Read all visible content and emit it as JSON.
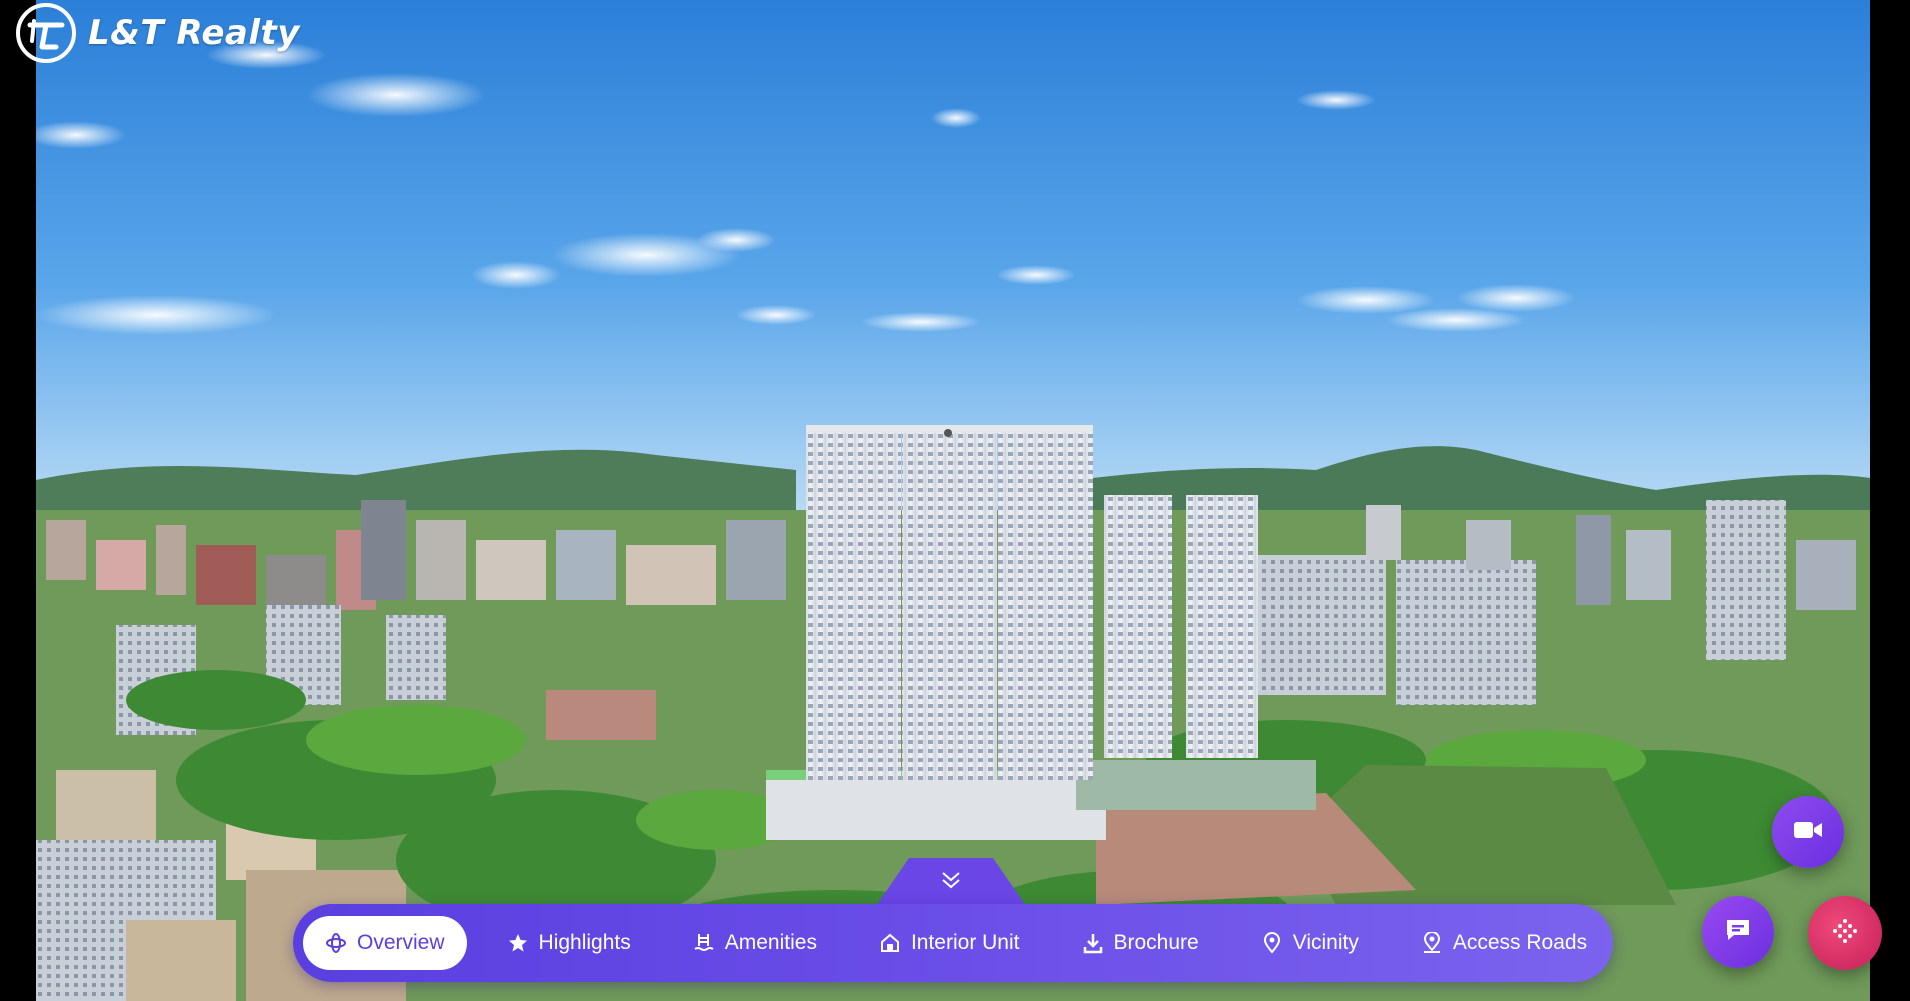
{
  "brand": {
    "logo_text": "L&T Realty",
    "logo_icon": "lt-logo-icon"
  },
  "nav": {
    "collapse_icon": "chevron-down-icon",
    "items": [
      {
        "label": "Overview",
        "icon": "orbit-icon",
        "active": true
      },
      {
        "label": "Highlights",
        "icon": "star-icon",
        "active": false
      },
      {
        "label": "Amenities",
        "icon": "pool-ladder-icon",
        "active": false
      },
      {
        "label": "Interior Unit",
        "icon": "home-icon",
        "active": false
      },
      {
        "label": "Brochure",
        "icon": "download-icon",
        "active": false
      },
      {
        "label": "Vicinity",
        "icon": "location-pin-icon",
        "active": false
      },
      {
        "label": "Access Roads",
        "icon": "location-pin-icon",
        "active": false
      }
    ]
  },
  "fabs": {
    "video": {
      "icon": "video-camera-icon"
    },
    "chat": {
      "icon": "chat-icon"
    },
    "menu": {
      "icon": "grid-dots-icon"
    }
  },
  "colors": {
    "accent": "#6a46e6",
    "menu_fab": "#d42a66",
    "sky": "#2e86de"
  }
}
